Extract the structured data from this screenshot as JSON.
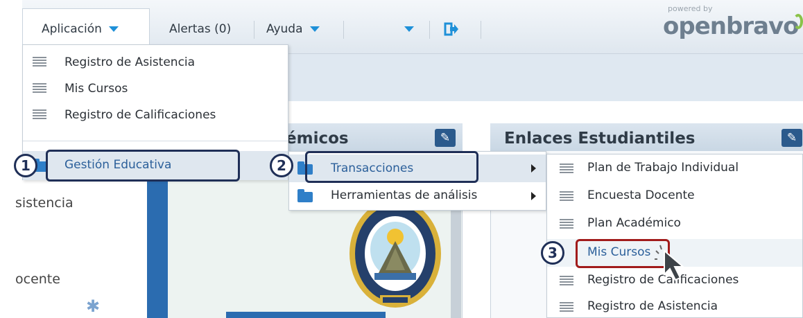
{
  "topbar": {
    "app_menu": "Aplicación",
    "alerts": "Alertas (0)",
    "help": "Ayuda",
    "brand_powered": "powered by",
    "brand_name": "openbravo"
  },
  "widgets": {
    "academic_title_fragment": "émicos",
    "student_links_title": "Enlaces Estudiantiles"
  },
  "left_panel": {
    "item1": "sistencia",
    "item2": "ocente"
  },
  "app_dropdown": {
    "items": [
      "Registro de Asistencia",
      "Mis Cursos",
      "Registro de Calificaciones"
    ],
    "folder": "Gestión Educativa"
  },
  "submenu2": {
    "items": [
      "Transacciones",
      "Herramientas de análisis"
    ]
  },
  "submenu3": {
    "items": [
      "Plan de Trabajo Individual",
      "Encuesta Docente",
      "Plan Académico",
      "Mis Cursos",
      "Registro de Calificaciones",
      "Registro de Asistencia"
    ]
  },
  "steps": [
    "1",
    "2",
    "3"
  ],
  "colors": {
    "accent": "#2b5f9a",
    "callout": "#1f2f57",
    "callout_highlight": "#a11b1b",
    "brand_green": "#8ac249"
  }
}
